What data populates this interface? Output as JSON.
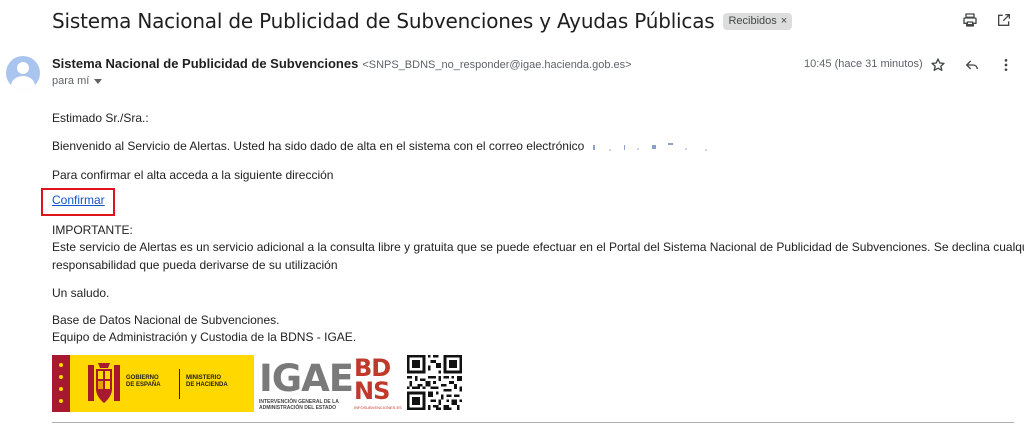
{
  "email": {
    "subject": "Sistema Nacional de Publicidad de Subvenciones y Ayudas Públicas",
    "label": "Recibidos",
    "sender_name": "Sistema Nacional de Publicidad de Subvenciones",
    "sender_email": "<SNPS_BDNS_no_responder@igae.hacienda.gob.es>",
    "to": "para mí",
    "time": "10:45 (hace 31 minutos)"
  },
  "body": {
    "greeting": "Estimado Sr./Sra.:",
    "welcome": "Bienvenido al Servicio de Alertas. Usted ha sido dado de alta en el sistema con el correo electrónico",
    "confirm_prompt": "Para confirmar el alta acceda a la siguiente dirección",
    "confirm_link": "Confirmar",
    "important_title": "IMPORTANTE:",
    "important_line1": "Este servicio de Alertas es un servicio adicional a la consulta libre y gratuita que se puede efectuar en el Portal del Sistema Nacional de Publicidad de Subvenciones. Se declina cualquier",
    "important_line2": "responsabilidad que pueda derivarse de su utilización",
    "closing": "Un saludo.",
    "signature_line1": "Base de Datos Nacional de Subvenciones.",
    "signature_line2": "Equipo de Administración y Custodia de la BDNS - IGAE."
  },
  "logos": {
    "gob_text1": "GOBIERNO",
    "gob_text2": "DE ESPAÑA",
    "min_text1": "MINISTERIO",
    "min_text2": "DE HACIENDA",
    "igae": "IGAE",
    "igae_sub1": "INTERVENCIÓN GENERAL DE LA",
    "igae_sub2": "ADMINISTRACIÓN DEL ESTADO",
    "bdns1": "BD",
    "bdns2": "NS",
    "bdns_sub": "INFOSUBVENCIONES.ES"
  },
  "icons": {
    "print": "printer-icon",
    "open_new": "open-in-new-window-icon",
    "star": "star-icon",
    "reply": "reply-icon",
    "more": "more-vertical-icon"
  },
  "colors": {
    "link": "#1155cc",
    "highlight_box": "#e0121b",
    "label_chip": "#dddddd"
  }
}
